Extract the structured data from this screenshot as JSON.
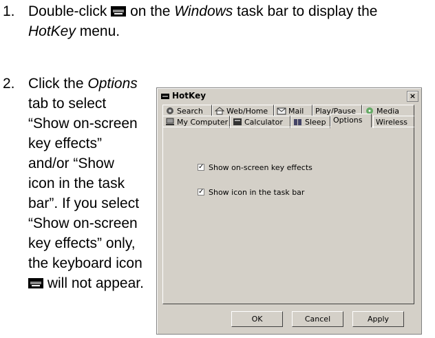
{
  "step1": {
    "number": "1.",
    "text_a": "Double-click",
    "text_b": "on the",
    "italic_windows": "Windows",
    "text_c": "task bar to display the",
    "italic_hotkey": "HotKey",
    "text_d": "menu."
  },
  "step2": {
    "number": "2.",
    "text_a": "Click the",
    "italic_options": "Options",
    "text_b": "tab to select “Show on-screen key effects” and/or “Show icon in the task bar”. If you select “Show on-screen key effects” only, the keyboard icon",
    "text_c": "will not appear."
  },
  "dialog": {
    "title": "HotKey",
    "close": "×",
    "tabs_row1": [
      "Search",
      "Web/Home",
      "Mail",
      "Play/Pause",
      "Media"
    ],
    "tabs_row2": [
      "My Computer",
      "Calculator",
      "Sleep",
      "Options",
      "Wireless"
    ],
    "active_tab": "Options",
    "options": [
      {
        "label": "Show on-screen key effects",
        "checked": true
      },
      {
        "label": "Show icon in the task bar",
        "checked": true
      }
    ],
    "buttons": {
      "ok": "OK",
      "cancel": "Cancel",
      "apply": "Apply"
    }
  },
  "icons": {
    "keyboard": "keyboard-icon",
    "check": "✓"
  }
}
